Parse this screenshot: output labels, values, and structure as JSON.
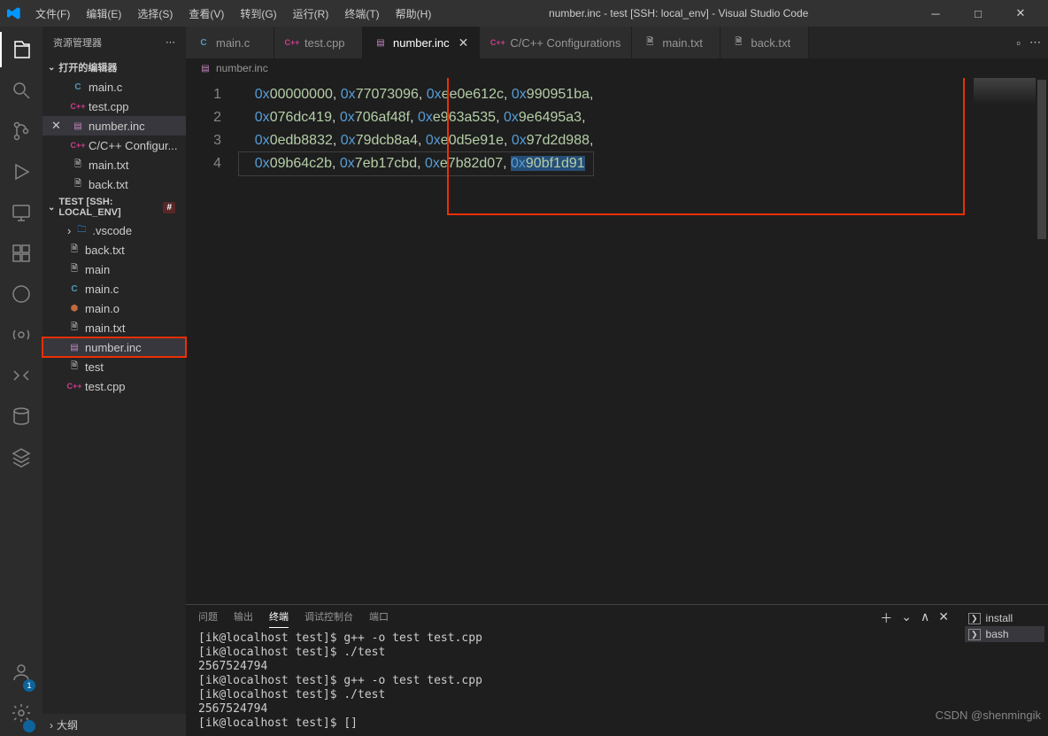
{
  "title": "number.inc - test [SSH: local_env] - Visual Studio Code",
  "menu": [
    "文件(F)",
    "编辑(E)",
    "选择(S)",
    "查看(V)",
    "转到(G)",
    "运行(R)",
    "终端(T)",
    "帮助(H)"
  ],
  "sidebar": {
    "title": "资源管理器",
    "open_editors_header": "打开的编辑器",
    "open_editors": [
      {
        "name": "main.c",
        "icon": "c"
      },
      {
        "name": "test.cpp",
        "icon": "cpp"
      },
      {
        "name": "number.inc",
        "icon": "inc",
        "active": true,
        "close": true
      },
      {
        "name": "C/C++ Configur...",
        "icon": "cpp-conf"
      },
      {
        "name": "main.txt",
        "icon": "txt"
      },
      {
        "name": "back.txt",
        "icon": "txt"
      }
    ],
    "workspace_header": "TEST [SSH: LOCAL_ENV]",
    "mod_badge": "#",
    "files": [
      {
        "name": ".vscode",
        "icon": "folder",
        "expandable": true
      },
      {
        "name": "back.txt",
        "icon": "txt"
      },
      {
        "name": "main",
        "icon": "bin"
      },
      {
        "name": "main.c",
        "icon": "c"
      },
      {
        "name": "main.o",
        "icon": "o"
      },
      {
        "name": "main.txt",
        "icon": "txt"
      },
      {
        "name": "number.inc",
        "icon": "inc",
        "active": true,
        "boxed": true
      },
      {
        "name": "test",
        "icon": "bin"
      },
      {
        "name": "test.cpp",
        "icon": "cpp"
      }
    ],
    "outline_label": "大纲"
  },
  "tabs": [
    {
      "name": "main.c",
      "icon": "c"
    },
    {
      "name": "test.cpp",
      "icon": "cpp"
    },
    {
      "name": "number.inc",
      "icon": "inc",
      "active": true,
      "close": true
    },
    {
      "name": "C/C++ Configurations",
      "icon": "cpp-conf"
    },
    {
      "name": "main.txt",
      "icon": "txt"
    },
    {
      "name": "back.txt",
      "icon": "txt"
    }
  ],
  "breadcrumb": "number.inc",
  "code_lines": [
    "    0x00000000, 0x77073096, 0xee0e612c, 0x990951ba,",
    "    0x076dc419, 0x706af48f, 0xe963a535, 0x9e6495a3,",
    "    0x0edb8832, 0x79dcb8a4, 0xe0d5e91e, 0x97d2d988,",
    "    0x09b64c2b, 0x7eb17cbd, 0xe7b82d07, 0x90bf1d91"
  ],
  "line_numbers": [
    "1",
    "2",
    "3",
    "4"
  ],
  "panel": {
    "tabs": [
      "问题",
      "输出",
      "终端",
      "调试控制台",
      "端口"
    ],
    "active_tab": 2,
    "terminal_lines": [
      "[ik@localhost test]$ g++ -o test test.cpp",
      "[ik@localhost test]$ ./test",
      "2567524794",
      "[ik@localhost test]$ g++ -o test test.cpp",
      "[ik@localhost test]$ ./test",
      "2567524794",
      "[ik@localhost test]$ []"
    ],
    "side": [
      {
        "label": "install",
        "icon": "term"
      },
      {
        "label": "bash",
        "icon": "term",
        "active": true
      }
    ]
  },
  "watermark": "CSDN @shenmingik",
  "account_badge": "1"
}
